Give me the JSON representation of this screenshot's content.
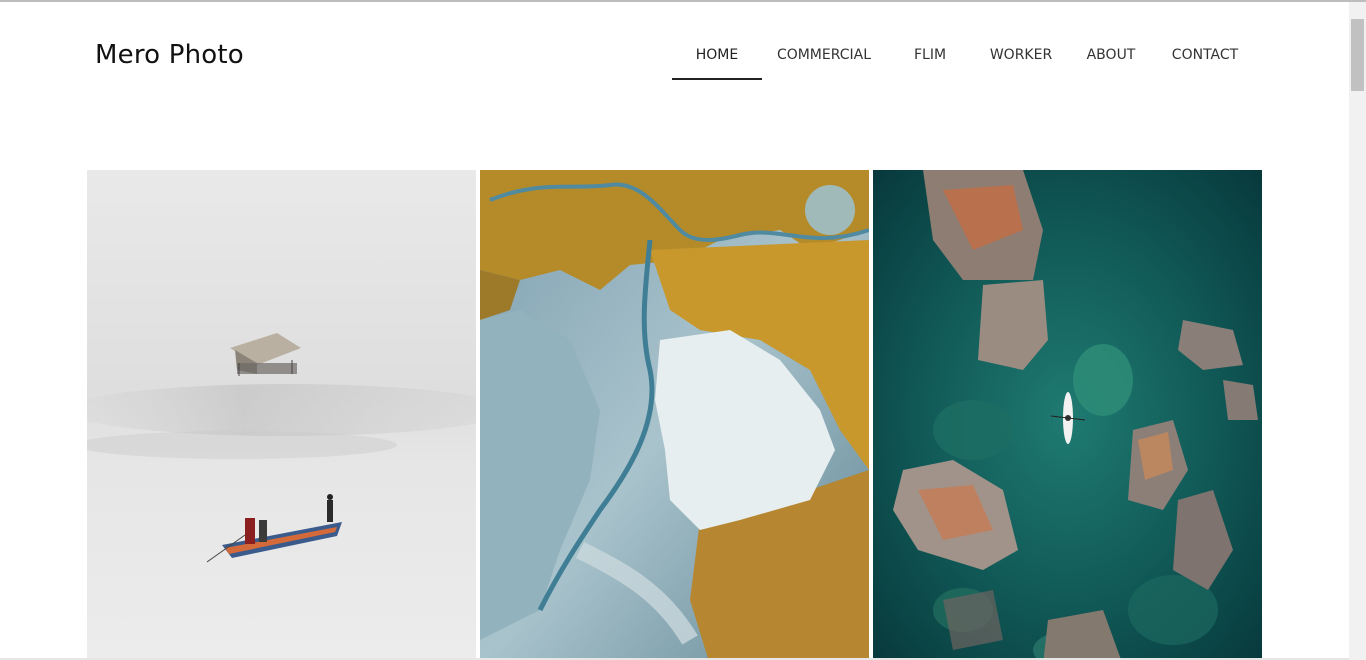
{
  "site": {
    "logo": "Mero Photo"
  },
  "nav": {
    "items": [
      {
        "label": "HOME",
        "active": true
      },
      {
        "label": "COMMERCIAL",
        "active": false
      },
      {
        "label": "FLIM",
        "active": false
      },
      {
        "label": "WORKER",
        "active": false
      },
      {
        "label": "ABOUT",
        "active": false
      },
      {
        "label": "CONTACT",
        "active": false
      }
    ]
  },
  "gallery": {
    "photos": [
      {
        "subject": "misty lake with hut and boat"
      },
      {
        "subject": "aerial river delta with autumn forest"
      },
      {
        "subject": "aerial turquoise water with rocks and kayak"
      }
    ]
  }
}
